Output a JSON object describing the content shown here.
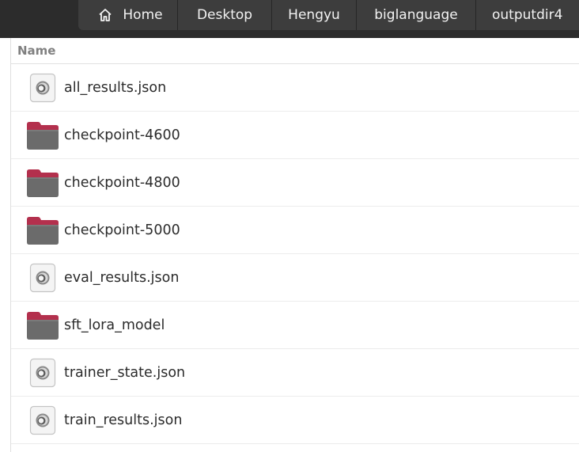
{
  "pathbar": {
    "crumbs": [
      "Home",
      "Desktop",
      "Hengyu",
      "biglanguage",
      "outputdir4"
    ]
  },
  "list": {
    "column_name": "Name",
    "rows": [
      {
        "name": "all_results.json",
        "icon": "json-file-icon"
      },
      {
        "name": "checkpoint-4600",
        "icon": "folder-icon"
      },
      {
        "name": "checkpoint-4800",
        "icon": "folder-icon"
      },
      {
        "name": "checkpoint-5000",
        "icon": "folder-icon"
      },
      {
        "name": "eval_results.json",
        "icon": "json-file-icon"
      },
      {
        "name": "sft_lora_model",
        "icon": "folder-icon"
      },
      {
        "name": "trainer_state.json",
        "icon": "json-file-icon"
      },
      {
        "name": "train_results.json",
        "icon": "json-file-icon"
      }
    ]
  },
  "colors": {
    "folder_body": "#6b6b6b",
    "folder_tab": "#b3304d",
    "pathbar_bg": "#3d3d3d",
    "topbar_bg": "#2c2c2c"
  }
}
